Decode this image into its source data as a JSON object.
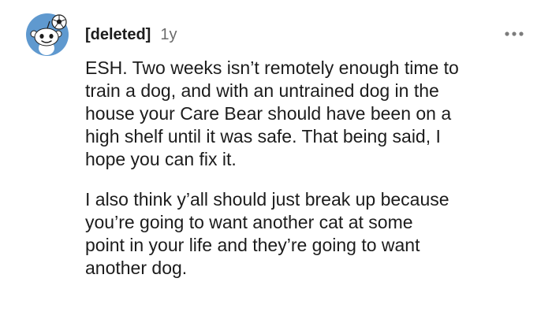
{
  "comment": {
    "author": "[deleted]",
    "age": "1y",
    "avatar_icon": "reddit-snoo-avatar-icon",
    "more_icon": "more-options-dots-icon",
    "accent_colors": {
      "avatar_background": "#5f99cf",
      "text": "#1c1c1c",
      "muted": "#6b6b6b"
    },
    "paragraphs": [
      "ESH. Two weeks isn’t remotely enough time to\ntrain a dog, and with an untrained dog in the\nhouse your Care Bear should have been on a\nhigh shelf until it was safe. That being said, I\nhope you can fix it.",
      "I also think y’all should just break up because\nyou’re going to want another cat at some\npoint in your life and they’re going to want\nanother dog."
    ]
  }
}
